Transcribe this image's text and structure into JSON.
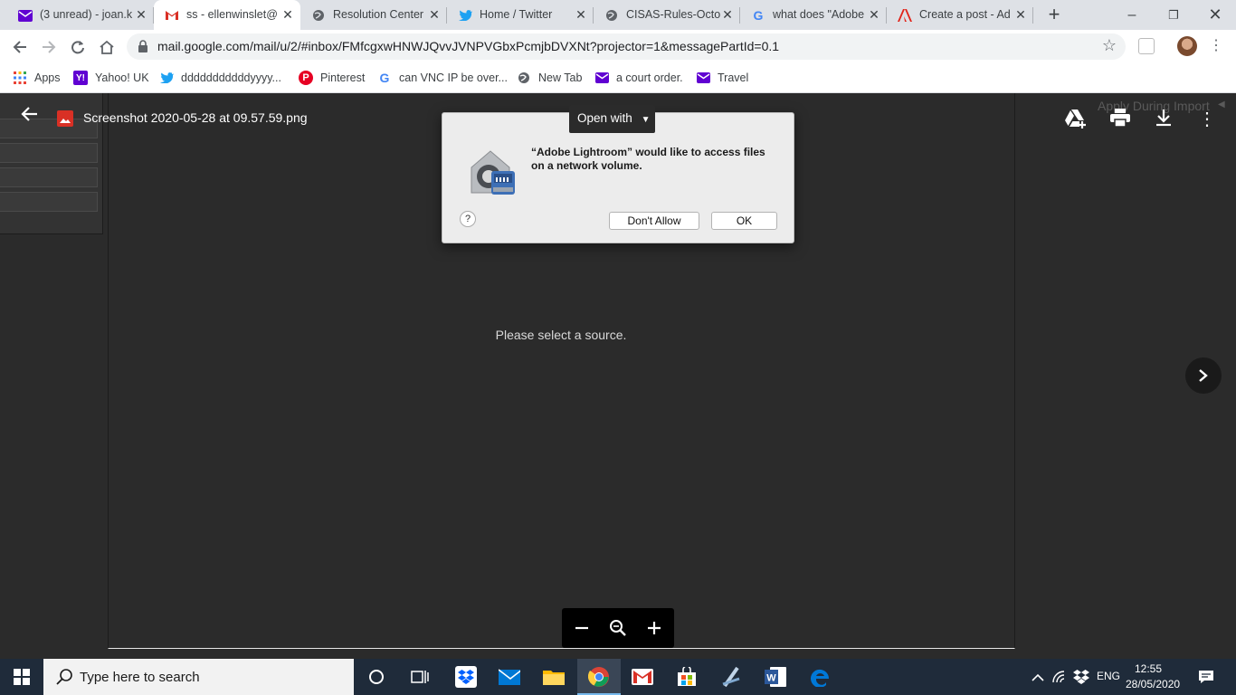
{
  "browser": {
    "tabs": [
      {
        "label": "(3 unread) - joan.k",
        "icon": "yahoo-mail-icon",
        "color": "#6001d2"
      },
      {
        "label": "ss - ellenwinslet@",
        "icon": "gmail-icon",
        "color": "#d93025",
        "active": true
      },
      {
        "label": "Resolution Center",
        "icon": "globe-icon",
        "color": "#5f6368"
      },
      {
        "label": "Home / Twitter",
        "icon": "twitter-icon",
        "color": "#1da1f2"
      },
      {
        "label": "CISAS-Rules-Octob",
        "icon": "globe-icon",
        "color": "#5f6368"
      },
      {
        "label": "what does \"Adobe",
        "icon": "google-icon",
        "color": "#4285f4"
      },
      {
        "label": "Create a post - Ad",
        "icon": "adobe-icon",
        "color": "#e1251b"
      }
    ],
    "url": "mail.google.com/mail/u/2/#inbox/FMfcgxwHNWJQvvJVNPVGbxPcmjbDVXNt?projector=1&messagePartId=0.1",
    "bookmarks": [
      {
        "label": "Apps",
        "icon": "apps-grid-icon"
      },
      {
        "label": "Yahoo! UK",
        "icon": "yahoo-icon"
      },
      {
        "label": "dddddddddddyyyy...",
        "icon": "twitter-icon"
      },
      {
        "label": "Pinterest",
        "icon": "pinterest-icon"
      },
      {
        "label": "can VNC IP be over...",
        "icon": "google-icon"
      },
      {
        "label": "New Tab",
        "icon": "globe-icon"
      },
      {
        "label": "a court order.",
        "icon": "yahoo-mail-icon"
      },
      {
        "label": "Travel",
        "icon": "yahoo-mail-icon"
      }
    ]
  },
  "viewer": {
    "filename": "Screenshot 2020-05-28 at 09.57.59.png",
    "open_with": "Open with",
    "apply_during_import": "Apply During Import",
    "select_source": "Please select a source."
  },
  "dialog": {
    "message": "“Adobe Lightroom” would like to access files on a network volume.",
    "help": "?",
    "dont_allow": "Don't Allow",
    "ok": "OK"
  },
  "taskbar": {
    "search_placeholder": "Type here to search",
    "language": "ENG",
    "time": "12:55",
    "date": "28/05/2020"
  }
}
